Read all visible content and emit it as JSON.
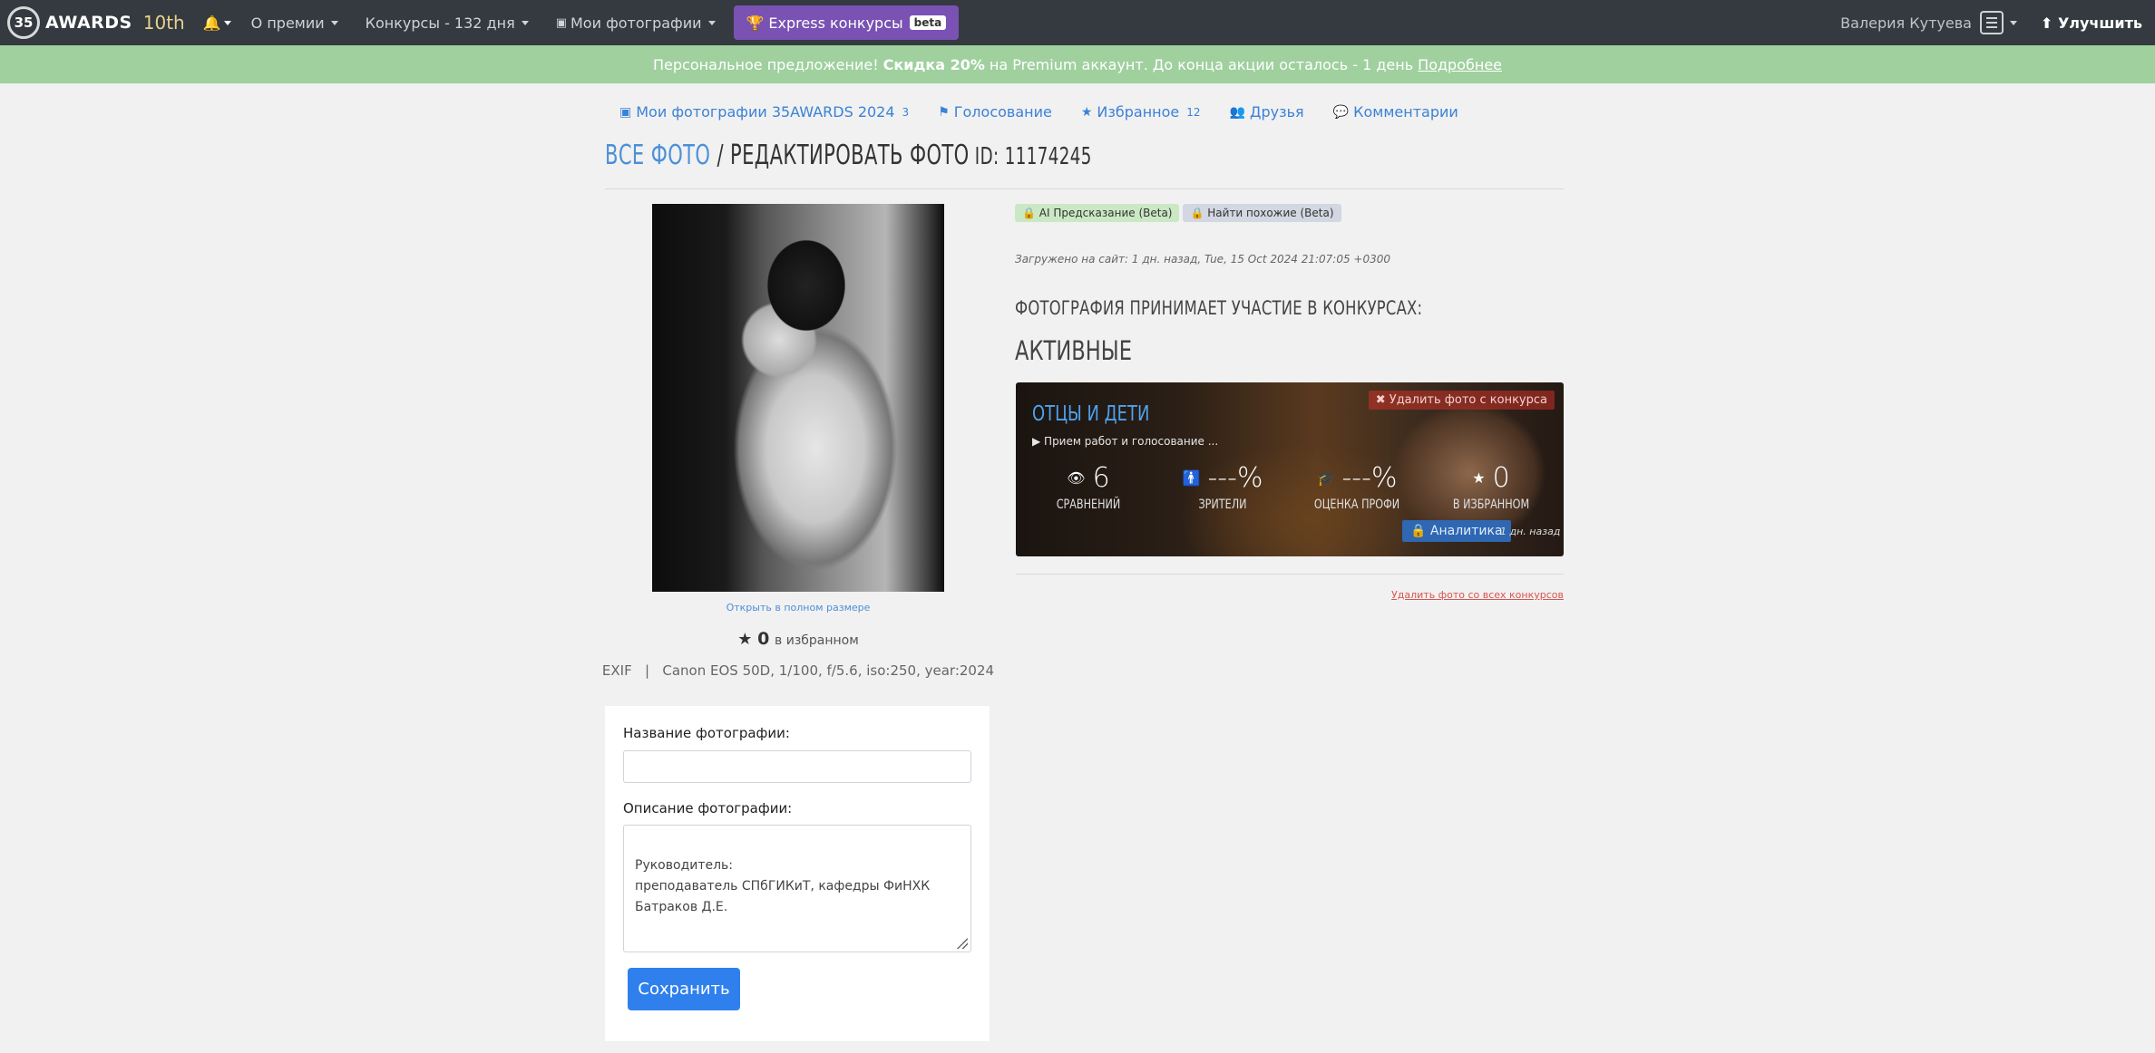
{
  "navbar": {
    "brand_logo": "35",
    "brand_name": "AWARDS",
    "brand_edition": "10th",
    "menu_about": "О премии",
    "menu_contests": "Конкурсы - 132 дня",
    "menu_my_photos": "Мои фотографии",
    "express_label": "Express конкурсы",
    "express_badge": "beta",
    "user_name": "Валерия Кутуева",
    "improve_label": "Улучшить"
  },
  "promo": {
    "text_before": "Персональное предложение!",
    "discount": "Скидка 20%",
    "text_middle": "на Premium аккаунт. До конца акции осталось - 1 день",
    "link": "Подробнее"
  },
  "subnav": {
    "my_photos": "Мои фотографии 35AWARDS 2024",
    "my_photos_count": "3",
    "voting": "Голосование",
    "favorites": "Избранное",
    "favorites_count": "12",
    "friends": "Друзья",
    "comments": "Комментарии"
  },
  "title": {
    "all_photos": "ВСЕ ФОТО",
    "separator": " / ",
    "edit": "РЕДАКТИРОВАТЬ ФОТО",
    "id_label": " ID:",
    "id_value": " 11174245"
  },
  "photo": {
    "open_full": "Открыть в полном размере",
    "favorites_value": "0",
    "favorites_label": "в избранном",
    "exif": "EXIF   |   Canon EOS 50D, 1/100, f/5.6, iso:250, year:2024"
  },
  "form": {
    "name_label": "Название фотографии:",
    "name_value": "",
    "description_label": "Описание фотографии:",
    "description_value": "Руководитель:\nпреподаватель СПбГИКиТ, кафедры ФиНХК\nБатраков Д.Е.",
    "save_label": "Сохранить"
  },
  "right": {
    "ai_badge": "AI Предсказание (Beta)",
    "similar_badge": "Найти похожие (Beta)",
    "uploaded": "Загружено на сайт: 1 дн. назад, Tue, 15 Oct 2024 21:07:05 +0300",
    "contests_heading": "ФОТОГРАФИЯ ПРИНИМАЕТ УЧАСТИЕ В КОНКУРСАХ:",
    "active_heading": "АКТИВНЫЕ",
    "remove_all": "Удалить фото со всех конкурсов"
  },
  "contest": {
    "title": "ОТЦЫ И ДЕТИ",
    "status": "▶ Прием работ и голосование ...",
    "remove_label": "Удалить фото с конкурса",
    "stats": [
      {
        "value": "6",
        "label": "СРАВНЕНИЙ",
        "icon": "eye-icon"
      },
      {
        "value": "---%",
        "label": "ЗРИТЕЛИ",
        "icon": "person-icon"
      },
      {
        "value": "---%",
        "label": "ОЦЕНКА ПРОФИ",
        "icon": "graduation-cap-icon"
      },
      {
        "value": "0",
        "label": "В ИЗБРАННОМ",
        "icon": "star-icon"
      }
    ],
    "analytics_label": "Аналитика",
    "ago": "1 дн. назад"
  },
  "colors": {
    "navbar": "#343a40",
    "promo": "#9fd09e",
    "express": "#7952b3",
    "link": "#3b82d6",
    "save_button": "#2f80ed"
  }
}
